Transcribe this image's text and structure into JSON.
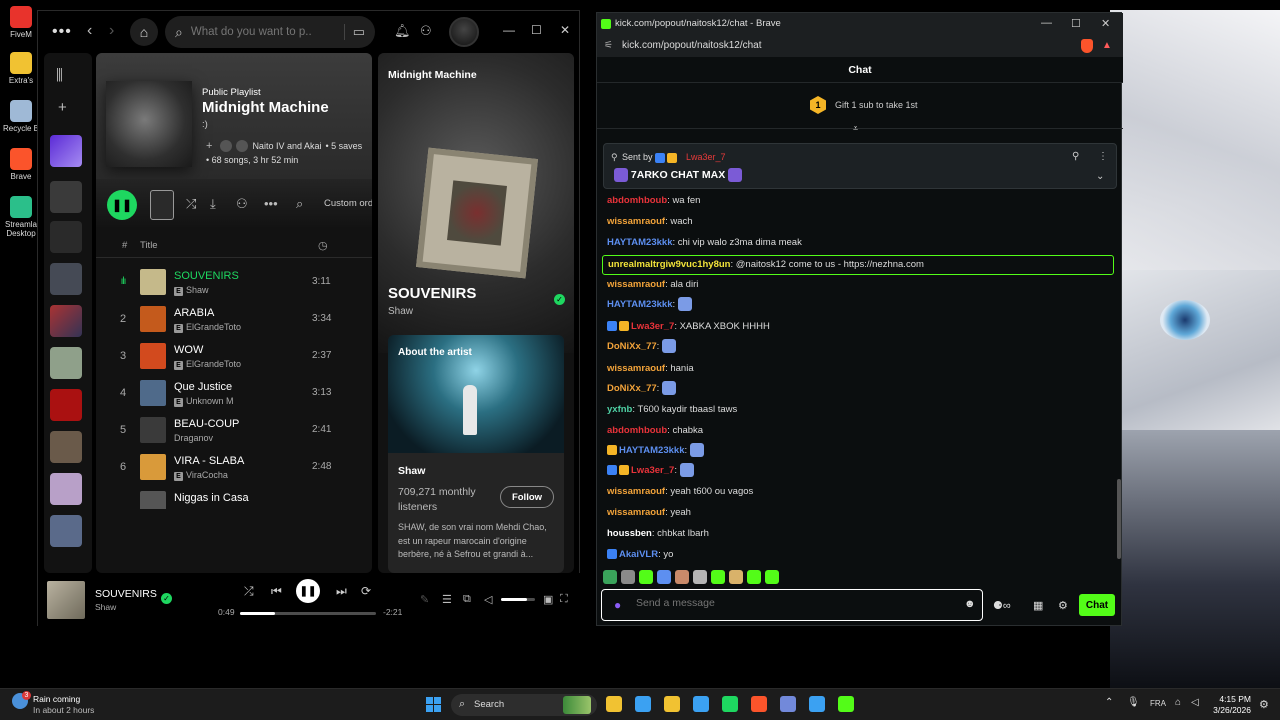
{
  "desktop": {
    "icons": [
      {
        "label": "FiveM",
        "color": "#e8332c"
      },
      {
        "label": "Extra's",
        "color": "#f1c232"
      },
      {
        "label": "Recycle B",
        "color": "#9fb9d6"
      },
      {
        "label": "Brave",
        "color": "#fb542b"
      },
      {
        "label": "Streamla Desktop",
        "color": "#2bbf8a"
      }
    ]
  },
  "spotify": {
    "search_placeholder": "What do you want to p...",
    "playlist": {
      "type": "Public Playlist",
      "title": "Midnight Machine",
      "description": ":)",
      "owners": "Naito IV and Akai",
      "saves": "• 5 saves",
      "meta": "• 68 songs, 3 hr 52 min"
    },
    "custom_order": "Custom ord",
    "table_head": {
      "hash": "#",
      "title": "Title"
    },
    "tracks": [
      {
        "num": "",
        "title": "SOUVENIRS",
        "artist": "Shaw",
        "duration": "3:11",
        "active": true,
        "color": "#c5b98a"
      },
      {
        "num": "2",
        "title": "ARABIA",
        "artist": "ElGrandeToto",
        "duration": "3:34",
        "active": false,
        "color": "#c45a1c"
      },
      {
        "num": "3",
        "title": "WOW",
        "artist": "ElGrandeToto",
        "duration": "2:37",
        "active": false,
        "color": "#d24a1e"
      },
      {
        "num": "4",
        "title": "Que Justice",
        "artist": "Unknown M",
        "duration": "3:13",
        "active": false,
        "color": "#4f6a8a"
      },
      {
        "num": "5",
        "title": "BEAU-COUP",
        "artist": "Draganov",
        "duration": "2:41",
        "active": false,
        "color": "#3a3a3a"
      },
      {
        "num": "6",
        "title": "VIRA - SLABA",
        "artist": "ViraCocha",
        "duration": "2:48",
        "active": false,
        "color": "#d99a3a"
      },
      {
        "num": "",
        "title": "Niggas in Casa",
        "artist": "",
        "duration": "",
        "active": false,
        "color": "#555555"
      }
    ],
    "now_playing": {
      "playlist": "Midnight Machine",
      "song": "SOUVENIRS",
      "artist": "Shaw",
      "about_label": "About the artist",
      "about_name": "Shaw",
      "listeners": "709,271 monthly listeners",
      "follow": "Follow",
      "bio": "SHAW, de son vrai nom Mehdi Chao, est un rapeur marocain d'origine berbère, né à Sefrou et grandi à..."
    },
    "player": {
      "title": "SOUVENIRS",
      "artist": "Shaw",
      "elapsed": "0:49",
      "remaining": "-2:21",
      "progress": 0.26,
      "volume": 0.75
    }
  },
  "brave": {
    "window_title": "kick.com/popout/naitosk12/chat - Brave",
    "url": "kick.com/popout/naitosk12/chat",
    "chat_title": "Chat",
    "gift_rank": "1",
    "gift_text": "Gift 1 sub to take 1st",
    "pinned": {
      "sent_by": "Sent by",
      "sender": "Lwa3er_7",
      "message": "7ARKO CHAT MAX"
    },
    "messages": [
      {
        "user": "abdomhboub",
        "color": "#e8333a",
        "text": "wa fen",
        "badges": [],
        "emotes": 0
      },
      {
        "user": "wissamraouf",
        "color": "#f2a33a",
        "text": "wach",
        "badges": [],
        "emotes": 0
      },
      {
        "user": "HAYTAM23kkk",
        "color": "#5d8ff0",
        "text": "chi vip walo z3ma dima meak",
        "badges": [],
        "emotes": 0
      },
      {
        "user": "unrealmaltrgiw9vuc1hy8un",
        "color": "#f2e33a",
        "text": "@naitosk12 come to us - https://nezhna.com",
        "badges": [],
        "emotes": 0,
        "highlight": true
      },
      {
        "user": "wissamraouf",
        "color": "#f2a33a",
        "text": "ala diri",
        "badges": [],
        "emotes": 0
      },
      {
        "user": "HAYTAM23kkk",
        "color": "#5d8ff0",
        "text": "",
        "badges": [],
        "emotes": 1
      },
      {
        "user": "Lwa3er_7",
        "color": "#e8333a",
        "text": "XABKA XBOK HHHH",
        "badges": [
          "blue",
          "gold"
        ],
        "emotes": 0
      },
      {
        "user": "DoNiXx_77",
        "color": "#f2a33a",
        "text": "",
        "badges": [],
        "emotes": 1
      },
      {
        "user": "wissamraouf",
        "color": "#f2a33a",
        "text": "hania",
        "badges": [],
        "emotes": 0
      },
      {
        "user": "DoNiXx_77",
        "color": "#f2a33a",
        "text": "",
        "badges": [],
        "emotes": 1
      },
      {
        "user": "yxfnb",
        "color": "#4fd1a5",
        "text": "T600 kaydir tbaasl taws",
        "badges": [],
        "emotes": 0
      },
      {
        "user": "abdomhboub",
        "color": "#e8333a",
        "text": "chabka",
        "badges": [],
        "emotes": 0
      },
      {
        "user": "HAYTAM23kkk",
        "color": "#5d8ff0",
        "text": "",
        "badges": [
          "gold"
        ],
        "emotes": 1
      },
      {
        "user": "Lwa3er_7",
        "color": "#e8333a",
        "text": "",
        "badges": [
          "blue",
          "gold"
        ],
        "emotes": 1
      },
      {
        "user": "wissamraouf",
        "color": "#f2a33a",
        "text": "yeah t600 ou vagos",
        "badges": [],
        "emotes": 0
      },
      {
        "user": "wissamraouf",
        "color": "#f2a33a",
        "text": "yeah",
        "badges": [],
        "emotes": 0
      },
      {
        "user": "houssben",
        "color": "#ffffff",
        "text": "chbkat lbarh",
        "badges": [],
        "emotes": 0
      },
      {
        "user": "AkaiVLR",
        "color": "#5d8ff0",
        "text": "yo",
        "badges": [
          "blue"
        ],
        "emotes": 0
      }
    ],
    "emote_colors": [
      "#3aa35b",
      "#8a8a8a",
      "#53fc18",
      "#5d8ff0",
      "#c98a6a",
      "#b5b5b5",
      "#53fc18",
      "#d9b26a",
      "#53fc18",
      "#53fc18"
    ],
    "input_placeholder": "Send a message",
    "send_label": "Chat"
  },
  "taskbar": {
    "weather_title": "Rain coming",
    "weather_sub": "In about 2 hours",
    "weather_badge": "3",
    "search_label": "Search",
    "apps": [
      "#f1c232",
      "#3ba1f2",
      "#f1c232",
      "#3ba1f2",
      "#1ed760",
      "#fb542b",
      "#7289da",
      "#3ba1f2",
      "#53fc18"
    ],
    "lang": "FRA",
    "time": "4:15 PM",
    "date": "3/26/2026"
  }
}
